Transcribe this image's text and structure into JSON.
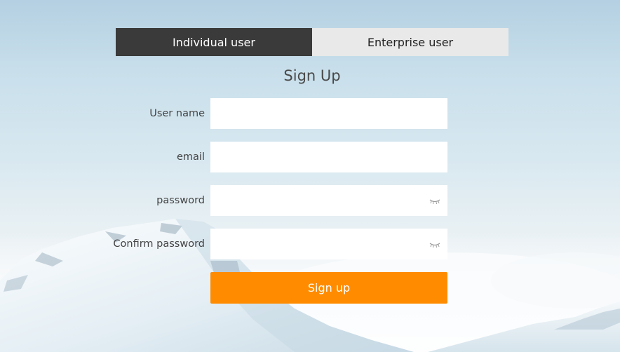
{
  "tabs": {
    "individual_label": "Individual user",
    "enterprise_label": "Enterprise user"
  },
  "form": {
    "title": "Sign Up",
    "username_label": "User name",
    "email_label": "email",
    "password_label": "password",
    "confirm_password_label": "Confirm password",
    "username_value": "",
    "email_value": "",
    "password_value": "",
    "confirm_password_value": "",
    "submit_label": "Sign up"
  },
  "icons": {
    "password_toggle": "eye-closed-icon",
    "confirm_password_toggle": "eye-closed-icon"
  },
  "colors": {
    "active_tab": "#3a3a3a",
    "inactive_tab": "#e9e9e9",
    "button": "#ff8c00"
  }
}
